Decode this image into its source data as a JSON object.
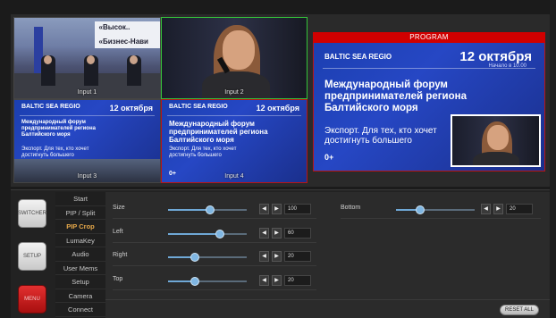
{
  "multiview": {
    "inputs": [
      {
        "label": "Input 1",
        "banner_line1": "«Высок..",
        "banner_line2": "«Бизнес-Нави"
      },
      {
        "label": "Input 2"
      },
      {
        "label": "Input 3",
        "slide_logo": "BALTIC SEA REGIO",
        "slide_date": "12 октября",
        "slide_title": "Международный форум предпринимателей региона Балтийского моря",
        "slide_sub": "Экспорт. Для тех, кто хочет достигнуть большего"
      },
      {
        "label": "Input 4",
        "slide_logo": "BALTIC SEA REGIO",
        "slide_date": "12 октября",
        "slide_title": "Международный форум предпринимателей региона Балтийского моря",
        "slide_sub": "Экспорт. Для тех, кто хочет достигнуть большего",
        "slide_zero": "0+"
      }
    ],
    "program": {
      "label": "PROGRAM",
      "logo": "BALTIC SEA REGIO",
      "date": "12 октября",
      "time": "Начало в 10.00",
      "title": "Международный форум предпринимателей региона Балтийского моря",
      "subtitle": "Экспорт. Для тех, кто хочет достигнуть большего",
      "age": "0+"
    }
  },
  "left_buttons": {
    "switcher": "SWITCHER",
    "setup": "SETUP",
    "menu": "MENU"
  },
  "menu": {
    "items": [
      "Start",
      "PIP / Split",
      "PIP Crop",
      "LumaKey",
      "Audio",
      "User Mems",
      "Setup",
      "Camera",
      "Connect"
    ],
    "active": "PIP Crop"
  },
  "pip_crop": {
    "size": {
      "label": "Size",
      "value": "100",
      "level": 0.53
    },
    "left": {
      "label": "Left",
      "value": "60",
      "level": 0.66
    },
    "right": {
      "label": "Right",
      "value": "20",
      "level": 0.34
    },
    "top": {
      "label": "Top",
      "value": "20",
      "level": 0.34
    },
    "bottom": {
      "label": "Bottom",
      "value": "20",
      "level": 0.31
    }
  },
  "reset_all": "RESET ALL",
  "colors": {
    "program_red": "#d00000",
    "preview_green": "#35c43a",
    "slider_accent": "#6fa8d6",
    "menu_active": "#e6a84a"
  }
}
